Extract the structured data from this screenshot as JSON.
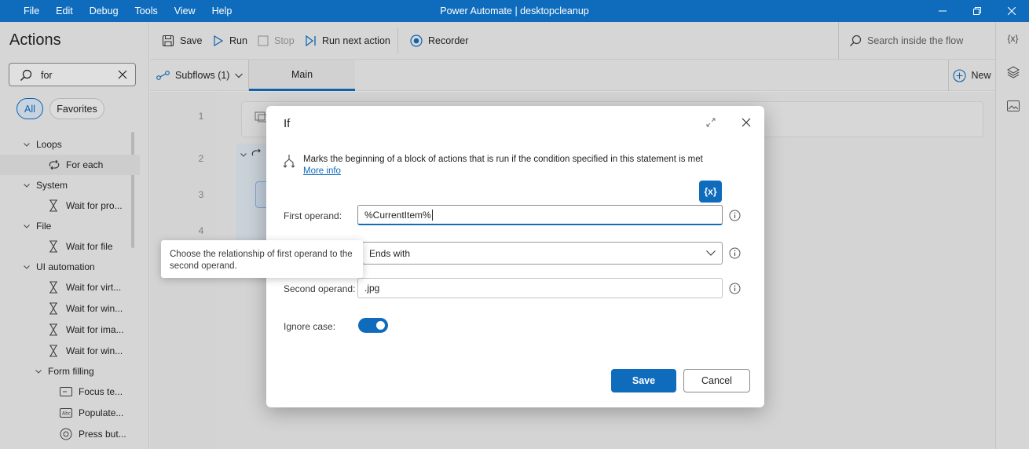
{
  "titlebar": {
    "menu": [
      "File",
      "Edit",
      "Debug",
      "Tools",
      "View",
      "Help"
    ],
    "title": "Power Automate | desktopcleanup"
  },
  "actions_panel": {
    "heading": "Actions",
    "search_value": "for",
    "filters": {
      "all": "All",
      "favorites": "Favorites"
    },
    "tree": [
      {
        "label": "Loops",
        "kind": "group",
        "icon": "chevron-down-icon"
      },
      {
        "label": "For each",
        "kind": "item",
        "icon": "loop-icon"
      },
      {
        "label": "System",
        "kind": "group",
        "icon": "chevron-down-icon"
      },
      {
        "label": "Wait for pro...",
        "kind": "item",
        "icon": "hourglass-icon"
      },
      {
        "label": "File",
        "kind": "group",
        "icon": "chevron-down-icon"
      },
      {
        "label": "Wait for file",
        "kind": "item",
        "icon": "hourglass-icon"
      },
      {
        "label": "UI automation",
        "kind": "group",
        "icon": "chevron-down-icon"
      },
      {
        "label": "Wait for virt...",
        "kind": "item",
        "icon": "hourglass-icon"
      },
      {
        "label": "Wait for win...",
        "kind": "item",
        "icon": "hourglass-icon"
      },
      {
        "label": "Wait for ima...",
        "kind": "item",
        "icon": "hourglass-icon"
      },
      {
        "label": "Wait for win...",
        "kind": "item",
        "icon": "hourglass-icon"
      },
      {
        "label": "Form filling",
        "kind": "subgroup",
        "icon": "chevron-down-icon"
      },
      {
        "label": "Focus te...",
        "kind": "subitem",
        "icon": "textbox-icon"
      },
      {
        "label": "Populate...",
        "kind": "subitem",
        "icon": "populate-icon"
      },
      {
        "label": "Press but...",
        "kind": "subitem",
        "icon": "press-button-icon"
      }
    ]
  },
  "toolbar": {
    "save": "Save",
    "run": "Run",
    "stop": "Stop",
    "run_next": "Run next action",
    "recorder": "Recorder",
    "search_placeholder": "Search inside the flow"
  },
  "tabs": {
    "subflows": "Subflows (1)",
    "main": "Main",
    "new": "New"
  },
  "flow": {
    "line_numbers": [
      "1",
      "2",
      "3",
      "4"
    ]
  },
  "right_rail": {
    "variables": "{x}"
  },
  "dialog": {
    "title": "If",
    "description": "Marks the beginning of a block of actions that is run if the condition specified in this statement is met",
    "more_info": "More info",
    "var_button": "{x}",
    "first_operand_label": "First operand:",
    "first_operand_value": "%CurrentItem%",
    "operator_value": "Ends with",
    "second_operand_label": "Second operand:",
    "second_operand_value": ".jpg",
    "ignore_case_label": "Ignore case:",
    "ignore_case_on": true,
    "save": "Save",
    "cancel": "Cancel"
  },
  "tooltip": {
    "text": "Choose the relationship of first operand to the second operand."
  },
  "colors": {
    "accent": "#0f6cbd",
    "titlebar": "#0f6cbd"
  }
}
